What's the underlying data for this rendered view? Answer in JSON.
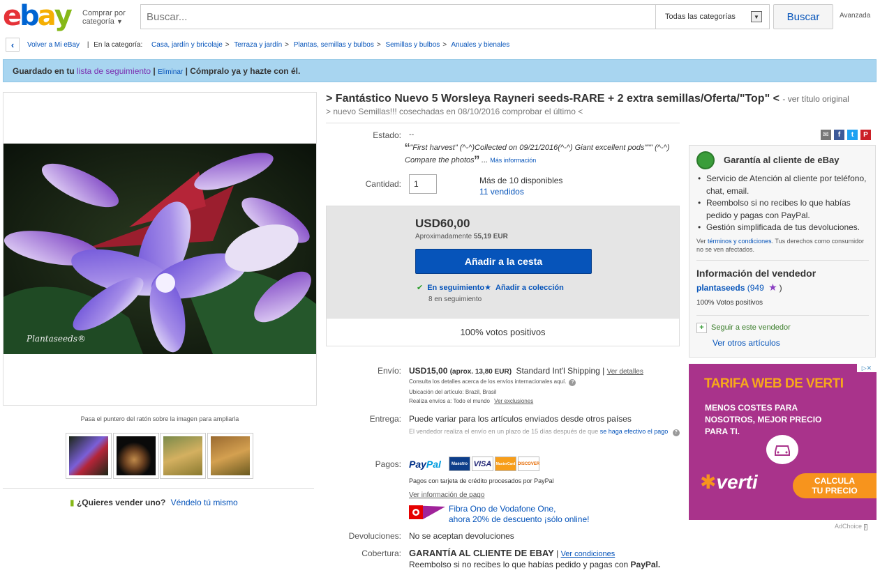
{
  "header": {
    "logo_letters": [
      "e",
      "b",
      "a",
      "y"
    ],
    "logo_colors": [
      "#e53238",
      "#0064d2",
      "#f5af02",
      "#86b817"
    ],
    "shop_by_category": "Comprar por categoría",
    "search_placeholder": "Buscar...",
    "category_select": "Todas las categorías",
    "search_button": "Buscar",
    "advanced": "Avanzada"
  },
  "breadcrumb": {
    "back": "Volver a Mi eBay",
    "in_category": "En la categoría:",
    "items": [
      "Casa, jardín y bricolaje",
      "Terraza y jardín",
      "Plantas, semillas y bulbos",
      "Semillas y bulbos",
      "Anuales y bienales"
    ]
  },
  "watch_banner": {
    "saved": "Guardado en tu",
    "watchlist": "lista de seguimiento",
    "remove": "Eliminar",
    "buy_now": "Cómpralo ya y hazte con él."
  },
  "images": {
    "watermark": "Plantaseeds®",
    "hover_text": "Pasa el puntero del ratón sobre la imagen para ampliarla"
  },
  "sell_prompt": {
    "question": "¿Quieres vender uno?",
    "link": "Véndelo tú mismo"
  },
  "item": {
    "title": "> Fantástico Nuevo 5 Worsleya Rayneri seeds-RARE + 2 extra semillas/Oferta/\"Top\" <",
    "see_original": "- ver título original",
    "subtitle": "> nuevo Semillas!!! cosechadas en 08/10/2016 comprobar el último <",
    "condition_label": "Estado:",
    "condition_value": "--",
    "condition_note": "\"First harvest\" (^-^)Collected on 09/21/2016(^-^) Giant excellent pods\"\"\" (^-^) Compare the photos",
    "more_info": "Más información",
    "quantity_label": "Cantidad:",
    "quantity_value": "1",
    "available": "Más de 10 disponibles",
    "sold": "11 vendidos"
  },
  "buybox": {
    "price": "USD60,00",
    "approx_label": "Aproximadamente",
    "approx_value": "55,19 EUR",
    "add_to_cart": "Añadir a la cesta",
    "watching": "En seguimiento",
    "add_collection": "Añadir a colección",
    "watch_count": "8 en seguimiento",
    "positive": "100% votos positivos"
  },
  "shipping": {
    "label": "Envío:",
    "price": "USD15,00",
    "approx": "(aprox. 13,80 EUR)",
    "service": "Standard Int'l Shipping",
    "details": "Ver detalles",
    "intl_note": "Consulta los detalles acerca de los envíos internacionales aquí.",
    "location": "Ubicación del artículo:  Brazil, Brasil",
    "ships_to": "Realiza envíos a:  Todo el mundo",
    "exclusions": "Ver exclusiones"
  },
  "delivery": {
    "label": "Entrega:",
    "value": "Puede variar para los artículos enviados desde otros países",
    "note": "El vendedor realiza el envío en un plazo de 15 días después de que",
    "note_link": "se haga efectivo el pago"
  },
  "payments": {
    "label": "Pagos:",
    "paypal_a": "Pay",
    "paypal_b": "Pal",
    "cards": [
      "Maestro",
      "VISA",
      "MasterCard",
      "DISCOVER"
    ],
    "card_note": "Pagos con tarjeta de crédito procesados por PayPal",
    "info_link": "Ver información de pago",
    "promo_line1": "Fibra Ono de Vodafone One,",
    "promo_line2": "ahora 20% de descuento ¡sólo online!"
  },
  "returns": {
    "label": "Devoluciones:",
    "value": "No se aceptan devoluciones"
  },
  "coverage": {
    "label": "Cobertura:",
    "title": "GARANTÍA AL CLIENTE DE EBAY",
    "link": "Ver condiciones",
    "note": "Reembolso si no recibes lo que habías pedido y pagas con",
    "paypal": "PayPal."
  },
  "guarantee": {
    "title": "Garantía al cliente de eBay",
    "items": [
      "Servicio de Atención al cliente por teléfono, chat, email.",
      "Reembolso si no recibes lo que habías pedido y pagas con PayPal.",
      "Gestión simplificada de tus devoluciones."
    ],
    "terms_pre": "Ver",
    "terms_link": "términos y condiciones",
    "terms_post": ". Tus derechos como consumidor no se ven afectados."
  },
  "seller": {
    "heading": "Información del vendedor",
    "name": "plantaseeds",
    "score": "(949",
    "score_close": ")",
    "positive": "100% Votos positivos",
    "follow": "Seguir a este vendedor",
    "other_items": "Ver otros artículos"
  },
  "ad": {
    "headline": "TARIFA WEB DE VERTI",
    "line1": "MENOS COSTES PARA",
    "line2": "NOSOTROS, MEJOR PRECIO",
    "line3": "PARA TI.",
    "brand": "verti",
    "cta1": "CALCULA",
    "cta2": "TU PRECIO",
    "adchoice": "AdChoice"
  }
}
